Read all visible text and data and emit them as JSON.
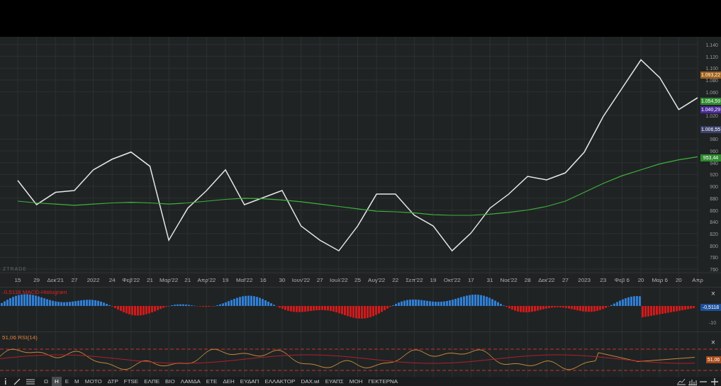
{
  "watermark": "ZTRADE",
  "price_chart": {
    "chart_data": {
      "type": "line",
      "categories": [
        "15",
        "29",
        "Δεκ'21",
        "27",
        "2022",
        "24",
        "Φεβ'22",
        "21",
        "Μαρ'22",
        "21",
        "Απρ'22",
        "19",
        "Μαϊ'22",
        "16",
        "30",
        "Ιουν'22",
        "27",
        "Ιουλ'22",
        "25",
        "Αυγ'22",
        "22",
        "Σεπ'22",
        "19",
        "Οκτ'22",
        "17",
        "31",
        "Νοε'22",
        "28",
        "Δεκ'22",
        "27",
        "2023",
        "23",
        "Φεβ 6",
        "20",
        "Μαρ 6",
        "20",
        "Απρ"
      ],
      "series": [
        {
          "color": "#e6e6e6",
          "values": [
            910,
            869,
            890,
            893,
            928,
            946,
            958,
            934,
            809,
            863,
            893,
            928,
            869,
            881,
            893,
            833,
            809,
            791,
            833,
            887,
            887,
            851,
            833,
            791,
            821,
            863,
            887,
            917,
            911,
            923,
            958,
            1018,
            1066,
            1114,
            1084,
            1030,
            1050
          ]
        },
        {
          "color": "#3cb33c",
          "values": [
            875,
            872,
            870,
            868,
            870,
            872,
            873,
            872,
            870,
            872,
            875,
            878,
            880,
            879,
            877,
            874,
            870,
            866,
            862,
            858,
            857,
            855,
            852,
            851,
            851,
            853,
            856,
            860,
            866,
            875,
            890,
            905,
            918,
            928,
            938,
            945,
            950
          ]
        }
      ],
      "ylim": [
        754,
        1153
      ],
      "grid": true,
      "yticks": [
        {
          "value": 1140,
          "label": "1.140"
        },
        {
          "value": 1120,
          "label": "1.120"
        },
        {
          "value": 1100,
          "label": "1.100"
        },
        {
          "value": 1080,
          "label": "1.080"
        },
        {
          "value": 1060,
          "label": "1.060"
        },
        {
          "value": 1020,
          "label": "1.020"
        },
        {
          "value": 980,
          "label": "980"
        },
        {
          "value": 960,
          "label": "960"
        },
        {
          "value": 940,
          "label": "940"
        },
        {
          "value": 920,
          "label": "920"
        },
        {
          "value": 900,
          "label": "900"
        },
        {
          "value": 880,
          "label": "880"
        },
        {
          "value": 860,
          "label": "860"
        },
        {
          "value": 840,
          "label": "840"
        },
        {
          "value": 820,
          "label": "820"
        },
        {
          "value": 800,
          "label": "800"
        },
        {
          "value": 780,
          "label": "780"
        },
        {
          "value": 760,
          "label": "760"
        }
      ]
    },
    "price_tags": [
      {
        "text": "1.093,22",
        "color": "#a0621b"
      },
      {
        "text": "1.054,59",
        "color": "#2e8b2e"
      },
      {
        "text": "1.040,29",
        "color": "#4b2a9a"
      },
      {
        "text": "1.006,55",
        "color": "#3a3f66"
      },
      {
        "text": "953,44",
        "color": "#2e8b2e"
      }
    ]
  },
  "macd": {
    "label": "-0,5118 MACD-Histogram",
    "tag": "-0,5118",
    "axis_label": "-10",
    "close": "×"
  },
  "rsi": {
    "label": "51,06 RSI(14)",
    "tag": "51,06",
    "close": "×"
  },
  "toolbar": {
    "items": [
      {
        "label": "Ω",
        "selected": false
      },
      {
        "label": "Η",
        "selected": true
      },
      {
        "label": "Ε",
        "selected": false
      },
      {
        "label": "Μ",
        "selected": false
      },
      {
        "label": "ΜΟΤΟ",
        "selected": false
      },
      {
        "label": "ΔΤΡ",
        "selected": false
      },
      {
        "label": "FTSE",
        "selected": false
      },
      {
        "label": "ΕΛΠΕ",
        "selected": false
      },
      {
        "label": "ΒΙΟ",
        "selected": false
      },
      {
        "label": "ΛΑΜΔΑ",
        "selected": false
      },
      {
        "label": "ΕΤΕ",
        "selected": false
      },
      {
        "label": "ΔΕΗ",
        "selected": false
      },
      {
        "label": "ΕΥΔΑΠ",
        "selected": false
      },
      {
        "label": "ΕΛΛΑΚΤΟΡ",
        "selected": false
      },
      {
        "label": "DAX.wi",
        "selected": false
      },
      {
        "label": "ΕΥΑΠΣ",
        "selected": false
      },
      {
        "label": "ΜΟΗ",
        "selected": false
      },
      {
        "label": "ΓΕΚΤΕΡΝΑ",
        "selected": false
      }
    ]
  }
}
